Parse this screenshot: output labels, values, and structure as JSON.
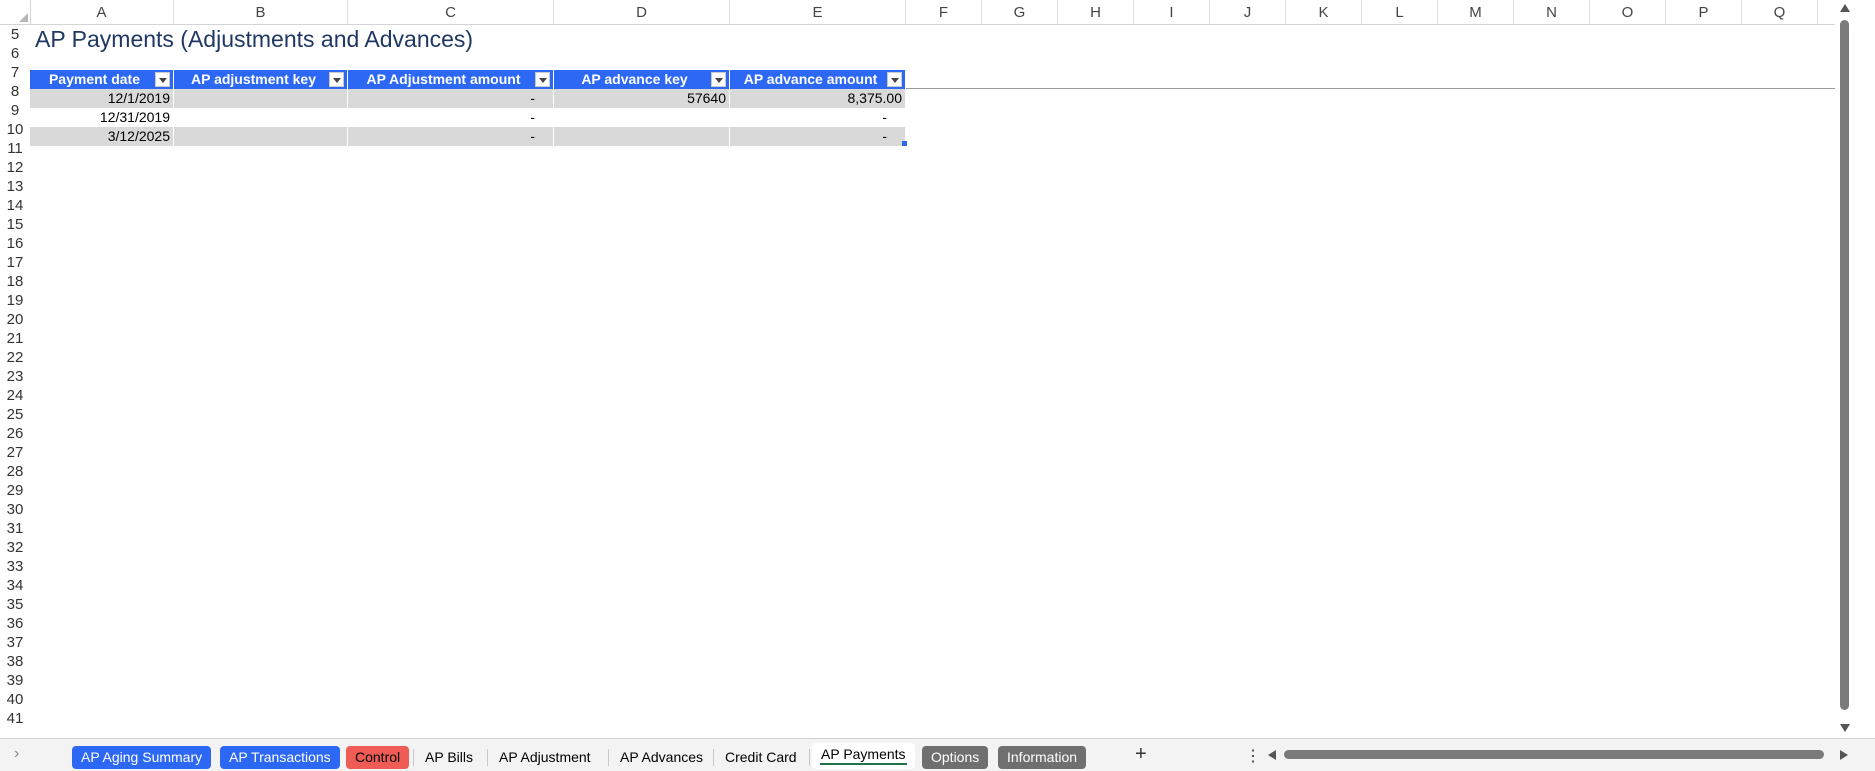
{
  "columns": [
    "A",
    "B",
    "C",
    "D",
    "E",
    "F",
    "G",
    "H",
    "I",
    "J",
    "K",
    "L",
    "M",
    "N",
    "O",
    "P",
    "Q",
    ""
  ],
  "rows": [
    "5",
    "6",
    "7",
    "8",
    "9",
    "10",
    "11",
    "12",
    "13",
    "14",
    "15",
    "16",
    "17",
    "18",
    "19",
    "20",
    "21",
    "22",
    "23",
    "24",
    "25",
    "26",
    "27",
    "28",
    "29",
    "30",
    "31",
    "32",
    "33",
    "34",
    "35",
    "36",
    "37",
    "38",
    "39",
    "40",
    "41"
  ],
  "sheet_title": "AP Payments (Adjustments and Advances)",
  "table": {
    "headers": [
      "Payment date",
      "AP adjustment key",
      "AP Adjustment amount",
      "AP advance key",
      "AP advance amount"
    ],
    "rows": [
      [
        "12/1/2019",
        "",
        "-",
        "57640",
        "8,375.00"
      ],
      [
        "12/31/2019",
        "",
        "-",
        "",
        "-"
      ],
      [
        "3/12/2025",
        "",
        "-",
        "",
        "-"
      ]
    ]
  },
  "tabs": [
    {
      "label": "AP Aging Summary",
      "style": "blue"
    },
    {
      "label": "AP Transactions",
      "style": "blue"
    },
    {
      "label": "Control",
      "style": "red"
    },
    {
      "label": "AP Bills",
      "style": "plain"
    },
    {
      "label": "AP Adjustment",
      "style": "plain"
    },
    {
      "label": "AP Advances",
      "style": "plain"
    },
    {
      "label": "Credit Card",
      "style": "plain"
    },
    {
      "label": "AP Payments",
      "style": "active"
    },
    {
      "label": "Options",
      "style": "gray"
    },
    {
      "label": "Information",
      "style": "gray"
    }
  ],
  "icons": {
    "add_sheet": "plus-icon",
    "more": "more-vertical-icon",
    "nav": "chevron-right-icon"
  },
  "colors": {
    "header_blue": "#2d68f5",
    "band_gray": "#d9d9d9",
    "title": "#1f3864",
    "control_red": "#ef5b55",
    "tab_gray": "#6f6f6f"
  }
}
